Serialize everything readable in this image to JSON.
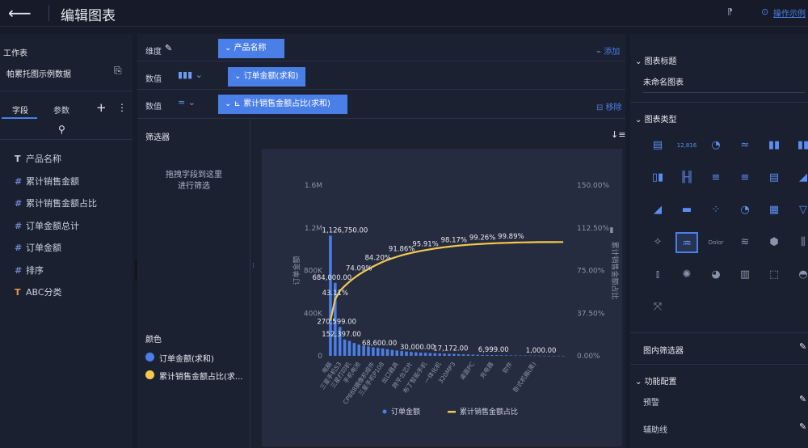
{
  "header": {
    "title": "编辑图表",
    "example_label": "操作示例"
  },
  "left": {
    "workspace_label": "工作表",
    "dataset": "帕累托图示例数据",
    "tabs": [
      "字段",
      "参数"
    ],
    "fields": [
      {
        "icon": "T",
        "name": "产品名称"
      },
      {
        "icon": "#",
        "name": "累计销售金额"
      },
      {
        "icon": "#",
        "name": "累计销售金额占比"
      },
      {
        "icon": "#",
        "name": "订单金额总计"
      },
      {
        "icon": "#",
        "name": "订单金额"
      },
      {
        "icon": "#",
        "name": "排序"
      },
      {
        "icon": "T",
        "name": "ABC分类"
      }
    ]
  },
  "config": {
    "dimension_label": "维度",
    "dimension_pill": "产品名称",
    "value_label": "数值",
    "value_pill1": "订单金额(求和)",
    "value_pill2": "累计销售金额占比(求和)",
    "add_label": "添加",
    "remove_label": "移除"
  },
  "filter": {
    "title": "筛选器",
    "hint1": "拖拽字段到这里",
    "hint2": "进行筛选"
  },
  "color": {
    "title": "颜色",
    "items": [
      "订单金额(求和)",
      "累计销售金额占比(求..."
    ]
  },
  "colors": {
    "bar": "#4a7fe8",
    "line": "#f5c84c",
    "accent": "#4a7fe8",
    "panel": "#1c2132"
  },
  "right": {
    "title_section": "图表标题",
    "title_value": "未命名图表",
    "type_section": "图表类型",
    "filter_section": "图内筛选器",
    "function_section": "功能配置",
    "warn_label": "预警",
    "aux_label": "辅助线"
  },
  "chart_data": {
    "type": "bar",
    "ylabel": "订单金额",
    "y2label": "累计销售金额占比",
    "ylim": [
      0,
      1600000
    ],
    "y2lim": [
      0,
      150
    ],
    "yticks": [
      "0",
      "400K",
      "800K",
      "1.2M",
      "1.6M"
    ],
    "y2ticks": [
      "0.00%",
      "37.50%",
      "75.00%",
      "112.50%",
      "150.00%"
    ],
    "categories": [
      "电脑",
      "三星手机S3",
      "三星打印机",
      "手机电池",
      "CP888摄像机组件",
      "三星手机P108",
      "出口器具",
      "跨平台芯片",
      "布丁智能手机",
      "一体化机",
      "320MP3",
      "桌面PC",
      "充电器",
      "软件",
      "卧式机箱(黑)"
    ],
    "values": [
      1126750,
      684000,
      270599,
      152397,
      140000,
      120000,
      105000,
      95000,
      88000,
      80000,
      75000,
      68600,
      62000,
      55000,
      50000,
      45000,
      40000,
      36000,
      33000,
      30000,
      28000,
      26000,
      24000,
      22000,
      20000,
      18500,
      17172,
      15500,
      14000,
      12500,
      11000,
      10000,
      9000,
      8000,
      7500,
      6999,
      6000,
      5000,
      4500,
      4000,
      3500,
      3000,
      2500,
      2000,
      1500,
      1000,
      800,
      600,
      400,
      200
    ],
    "bar_labels": [
      {
        "i": 0,
        "text": "1,126,750.00"
      },
      {
        "i": 1,
        "text": "684,000.00"
      },
      {
        "i": 2,
        "text": "270,599.00"
      },
      {
        "i": 3,
        "text": "152,397.00"
      },
      {
        "i": 11,
        "text": "68,600.00"
      },
      {
        "i": 19,
        "text": "30,000.00"
      },
      {
        "i": 26,
        "text": "17,172.00"
      },
      {
        "i": 35,
        "text": "6,999.00"
      },
      {
        "i": 45,
        "text": "1,000.00"
      }
    ],
    "line_labels": [
      {
        "i": 1,
        "text": "43.11%"
      },
      {
        "i": 6,
        "text": "74.09%"
      },
      {
        "i": 10,
        "text": "84.20%"
      },
      {
        "i": 15,
        "text": "91.86%"
      },
      {
        "i": 20,
        "text": "95.91%"
      },
      {
        "i": 26,
        "text": "98.17%"
      },
      {
        "i": 32,
        "text": "99.26%"
      },
      {
        "i": 38,
        "text": "99.89%"
      }
    ],
    "legend": [
      "订单金额",
      "累计销售金额占比"
    ]
  }
}
